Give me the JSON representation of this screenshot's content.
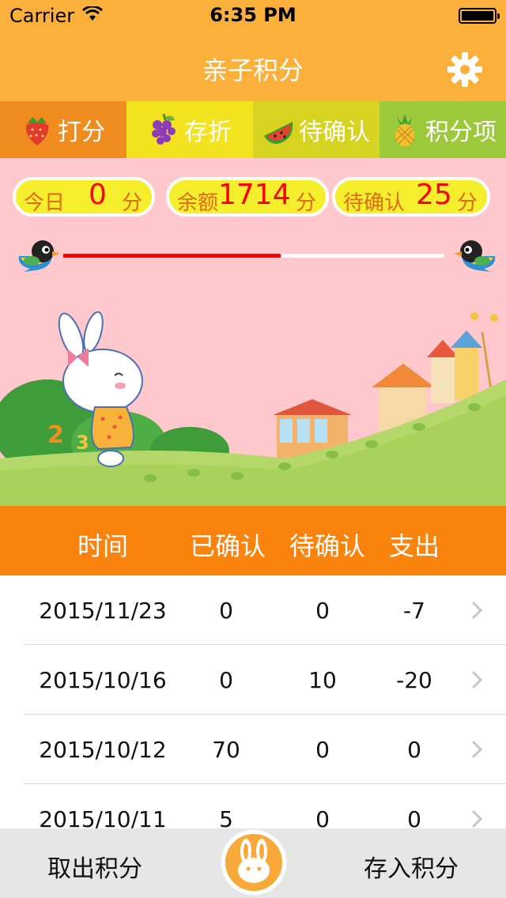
{
  "status_bar": {
    "carrier": "Carrier",
    "time": "6:35 PM"
  },
  "nav": {
    "title": "亲子积分",
    "settings_icon": "gear-icon"
  },
  "tabs": [
    {
      "label": "打分",
      "icon": "strawberry-icon",
      "color": "#F08C1E"
    },
    {
      "label": "存折",
      "icon": "grapes-icon",
      "color": "#F3E21E"
    },
    {
      "label": "待确认",
      "icon": "watermelon-icon",
      "color": "#D7D421"
    },
    {
      "label": "积分项",
      "icon": "pineapple-icon",
      "color": "#9CC93B"
    }
  ],
  "summary": {
    "today": {
      "label": "今日",
      "value": "0",
      "unit": "分"
    },
    "balance": {
      "label": "余额",
      "value": "1714",
      "unit": "分"
    },
    "pending": {
      "label": "待确认",
      "value": "25",
      "unit": "分"
    }
  },
  "progress": {
    "fraction": 0.57
  },
  "table": {
    "headers": [
      "时间",
      "已确认",
      "待确认",
      "支出"
    ],
    "rows": [
      [
        "2015/11/23",
        "0",
        "0",
        "-7"
      ],
      [
        "2015/10/16",
        "0",
        "10",
        "-20"
      ],
      [
        "2015/10/12",
        "70",
        "0",
        "0"
      ],
      [
        "2015/10/11",
        "5",
        "0",
        "0"
      ]
    ]
  },
  "bottom_bar": {
    "withdraw": "取出积分",
    "deposit": "存入积分",
    "center_icon": "rabbit-icon"
  },
  "colors": {
    "accent": "#FBB03B",
    "header": "#F9830C",
    "hero_bg": "#FFC8CC",
    "value": "#FF0000"
  }
}
